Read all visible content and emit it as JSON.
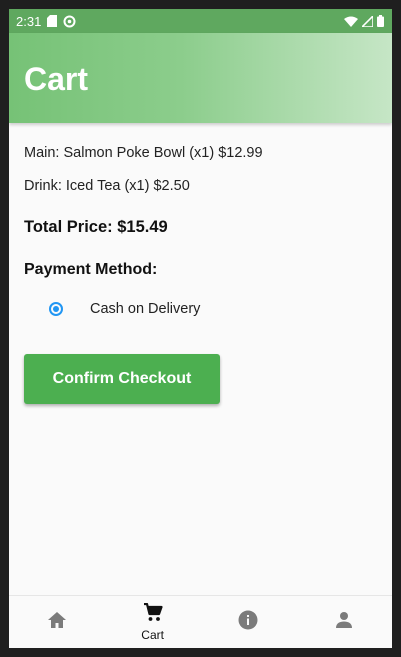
{
  "status_bar": {
    "time": "2:31"
  },
  "app_bar": {
    "title": "Cart"
  },
  "cart": {
    "items": [
      {
        "text": "Main: Salmon Poke Bowl (x1)  $12.99"
      },
      {
        "text": "Drink: Iced Tea (x1)  $2.50"
      }
    ],
    "total_text": "Total Price: $15.49",
    "payment_heading": "Payment Method:",
    "payment_option": {
      "label": "Cash on Delivery",
      "selected": true
    },
    "confirm_label": "Confirm Checkout"
  },
  "bottom_nav": {
    "items": [
      {
        "icon": "home-icon",
        "label": "",
        "active": false
      },
      {
        "icon": "cart-icon",
        "label": "Cart",
        "active": true
      },
      {
        "icon": "info-icon",
        "label": "",
        "active": false
      },
      {
        "icon": "person-icon",
        "label": "",
        "active": false
      }
    ]
  },
  "colors": {
    "accent": "#4caf50",
    "radio": "#2196f3",
    "app_bar_start": "#76c276",
    "app_bar_end": "#c6e6c6"
  }
}
